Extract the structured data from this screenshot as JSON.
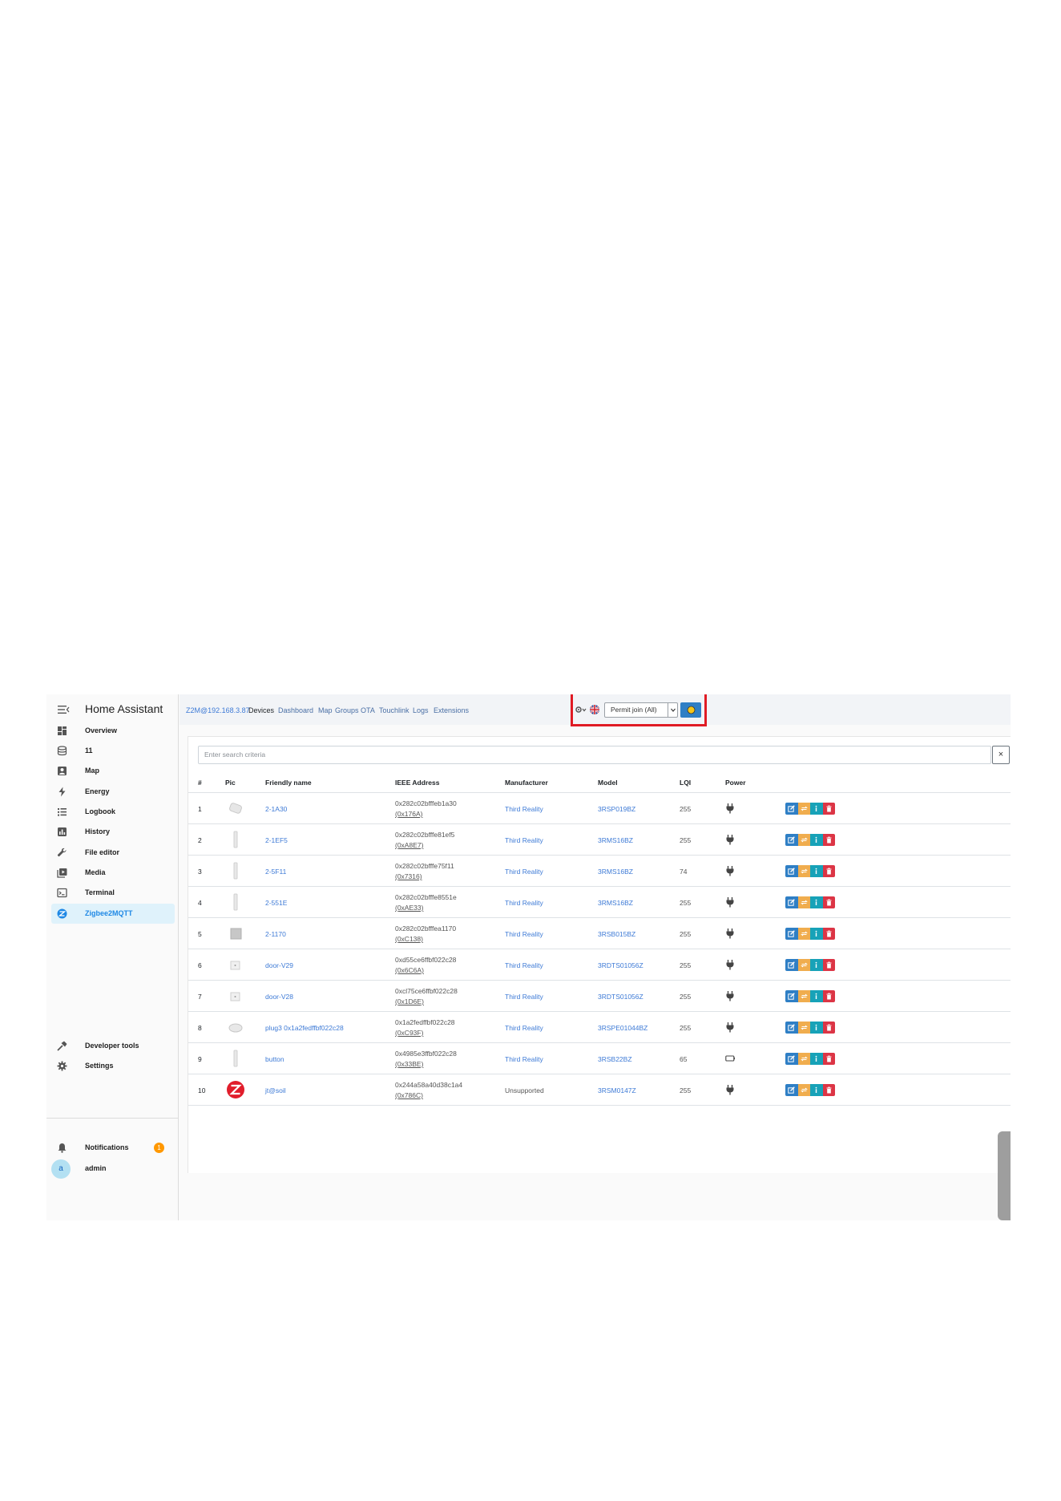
{
  "sidebar": {
    "title": "Home Assistant",
    "items": [
      {
        "label": "Overview",
        "icon": "dashboard-icon"
      },
      {
        "label": "11",
        "icon": "layers-icon"
      },
      {
        "label": "Map",
        "icon": "map-icon"
      },
      {
        "label": "Energy",
        "icon": "lightning-icon"
      },
      {
        "label": "Logbook",
        "icon": "list-icon"
      },
      {
        "label": "History",
        "icon": "chart-icon"
      },
      {
        "label": "File editor",
        "icon": "wrench-icon"
      },
      {
        "label": "Media",
        "icon": "media-icon"
      },
      {
        "label": "Terminal",
        "icon": "terminal-icon"
      },
      {
        "label": "Zigbee2MQTT",
        "icon": "zigbee-icon",
        "active": true
      }
    ],
    "bottom": [
      {
        "label": "Developer tools",
        "icon": "hammer-icon"
      },
      {
        "label": "Settings",
        "icon": "gear-icon"
      }
    ],
    "notifications": {
      "label": "Notifications",
      "count": "1"
    },
    "user": {
      "avatar": "a",
      "name": "admin"
    }
  },
  "nav": {
    "host": "Z2M@192.168.3.87",
    "links": [
      "Devices",
      "Dashboard",
      "Map",
      "Groups",
      "OTA",
      "Touchlink",
      "Logs",
      "Extensions"
    ],
    "permit_join": "Permit join (All)"
  },
  "search": {
    "placeholder": "Enter search criteria",
    "clear": "×"
  },
  "columns": {
    "num": "#",
    "pic": "Pic",
    "name": "Friendly name",
    "ieee": "IEEE Address",
    "manufacturer": "Manufacturer",
    "model": "Model",
    "lqi": "LQI",
    "power": "Power"
  },
  "devices": [
    {
      "num": "1",
      "name": "2-1A30",
      "ieee": "0x282c02bfffeb1a30",
      "nwk": "(0x176A)",
      "manufacturer": "Third Reality",
      "model": "3RSP019BZ",
      "lqi": "255",
      "power": "mains",
      "pic": "plug"
    },
    {
      "num": "2",
      "name": "2-1EF5",
      "ieee": "0x282c02bfffe81ef5",
      "nwk": "(0xA8E7)",
      "manufacturer": "Third Reality",
      "model": "3RMS16BZ",
      "lqi": "255",
      "power": "mains",
      "pic": "bar"
    },
    {
      "num": "3",
      "name": "2-5F11",
      "ieee": "0x282c02bfffe75f11",
      "nwk": "(0x7316)",
      "manufacturer": "Third Reality",
      "model": "3RMS16BZ",
      "lqi": "74",
      "power": "mains",
      "pic": "bar"
    },
    {
      "num": "4",
      "name": "2-551E",
      "ieee": "0x282c02bfffe8551e",
      "nwk": "(0xAE33)",
      "manufacturer": "Third Reality",
      "model": "3RMS16BZ",
      "lqi": "255",
      "power": "mains",
      "pic": "bar"
    },
    {
      "num": "5",
      "name": "2-1170",
      "ieee": "0x282c02bfffea1170",
      "nwk": "(0xC138)",
      "manufacturer": "Third Reality",
      "model": "3RSB015BZ",
      "lqi": "255",
      "power": "mains",
      "pic": "square"
    },
    {
      "num": "6",
      "name": "door-V29",
      "ieee": "0xd55ce6ffbf022c28",
      "nwk": "(0x6C6A)",
      "manufacturer": "Third Reality",
      "model": "3RDTS01056Z",
      "lqi": "255",
      "power": "mains",
      "pic": "small"
    },
    {
      "num": "7",
      "name": "door-V28",
      "ieee": "0xcl75ce6ffbf022c28",
      "nwk": "(0x1D6E)",
      "manufacturer": "Third Reality",
      "model": "3RDTS01056Z",
      "lqi": "255",
      "power": "mains",
      "pic": "small"
    },
    {
      "num": "8",
      "name": "plug3 0x1a2fedffbf022c28",
      "ieee": "0x1a2fedffbf022c28",
      "nwk": "(0xC93F)",
      "manufacturer": "Third Reality",
      "model": "3RSPE01044BZ",
      "lqi": "255",
      "power": "mains",
      "pic": "disc"
    },
    {
      "num": "9",
      "name": "button",
      "ieee": "0x4985e3ffbf022c28",
      "nwk": "(0x33BE)",
      "manufacturer": "Third Reality",
      "model": "3RSB22BZ",
      "lqi": "65",
      "power": "battery",
      "pic": "bar"
    },
    {
      "num": "10",
      "name": "jt@soil",
      "ieee": "0x244a58a40d38c1a4",
      "nwk": "(0x786C)",
      "manufacturer": "Unsupported",
      "model": "3RSM0147Z",
      "lqi": "255",
      "power": "mains",
      "pic": "zigbee"
    }
  ],
  "colors": {
    "accent": "#3d7ad6",
    "highlight": "#e01b24",
    "edit": "#2f7fc5",
    "rename": "#f0ad4e",
    "info": "#17a2b8",
    "delete": "#dc3545"
  }
}
